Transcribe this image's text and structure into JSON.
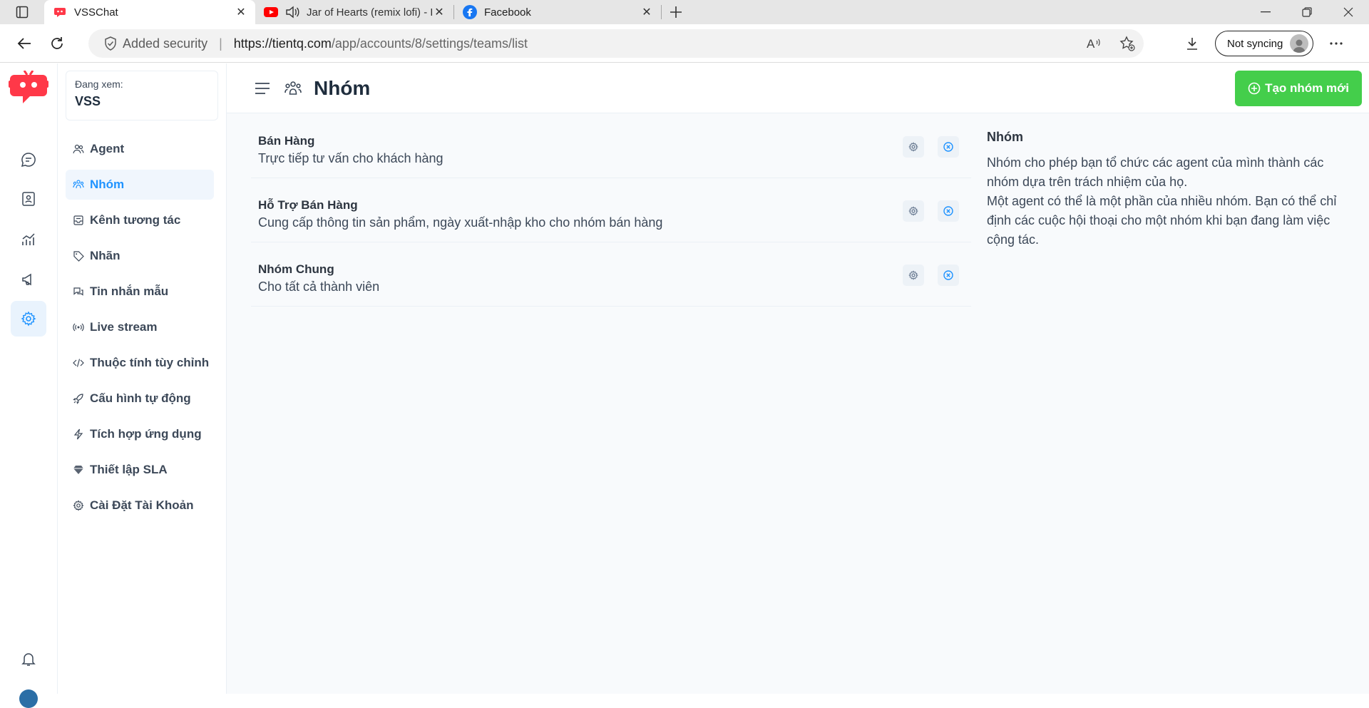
{
  "browser": {
    "tabs": [
      {
        "title": "VSSChat",
        "active": true
      },
      {
        "title": "Jar of Hearts (remix lofi) - Fa",
        "active": false
      },
      {
        "title": "Facebook",
        "active": false
      }
    ],
    "security_label": "Added security",
    "url_host": "https://tientq.com",
    "url_path": "/app/accounts/8/settings/teams/list",
    "sync_label": "Not syncing"
  },
  "account": {
    "label": "Đang xem:",
    "name": "VSS"
  },
  "menu": [
    {
      "label": "Agent",
      "icon": "people-icon"
    },
    {
      "label": "Nhóm",
      "icon": "team-icon",
      "active": true
    },
    {
      "label": "Kênh tương tác",
      "icon": "inbox-icon"
    },
    {
      "label": "Nhãn",
      "icon": "tag-icon"
    },
    {
      "label": "Tin nhắn mẫu",
      "icon": "chat-bubbles-icon"
    },
    {
      "label": "Live stream",
      "icon": "broadcast-icon"
    },
    {
      "label": "Thuộc tính tùy chỉnh",
      "icon": "code-icon"
    },
    {
      "label": "Cấu hình tự động",
      "icon": "rocket-icon"
    },
    {
      "label": "Tích hợp ứng dụng",
      "icon": "flash-icon"
    },
    {
      "label": "Thiết lập SLA",
      "icon": "diamond-icon"
    },
    {
      "label": "Cài Đặt Tài Khoản",
      "icon": "gear-icon"
    }
  ],
  "header": {
    "title": "Nhóm",
    "new_button": "Tạo nhóm mới"
  },
  "teams": [
    {
      "name": "Bán Hàng",
      "description": "Trực tiếp tư vấn cho khách hàng"
    },
    {
      "name": "Hỗ Trợ Bán Hàng",
      "description": "Cung cấp thông tin sản phẩm, ngày xuất-nhập kho cho nhóm bán hàng"
    },
    {
      "name": "Nhóm Chung",
      "description": "Cho tất cả thành viên"
    }
  ],
  "help": {
    "title": "Nhóm",
    "line1": "Nhóm cho phép bạn tổ chức các agent của mình thành các nhóm dựa trên trách nhiệm của họ.",
    "line2": "Một agent có thể là một phần của nhiều nhóm. Bạn có thể chỉ định các cuộc hội thoại cho một nhóm khi bạn đang làm việc cộng tác."
  },
  "colors": {
    "accent": "#1f93ff",
    "primary_button": "#44ce4b",
    "logo": "#ff3848"
  }
}
